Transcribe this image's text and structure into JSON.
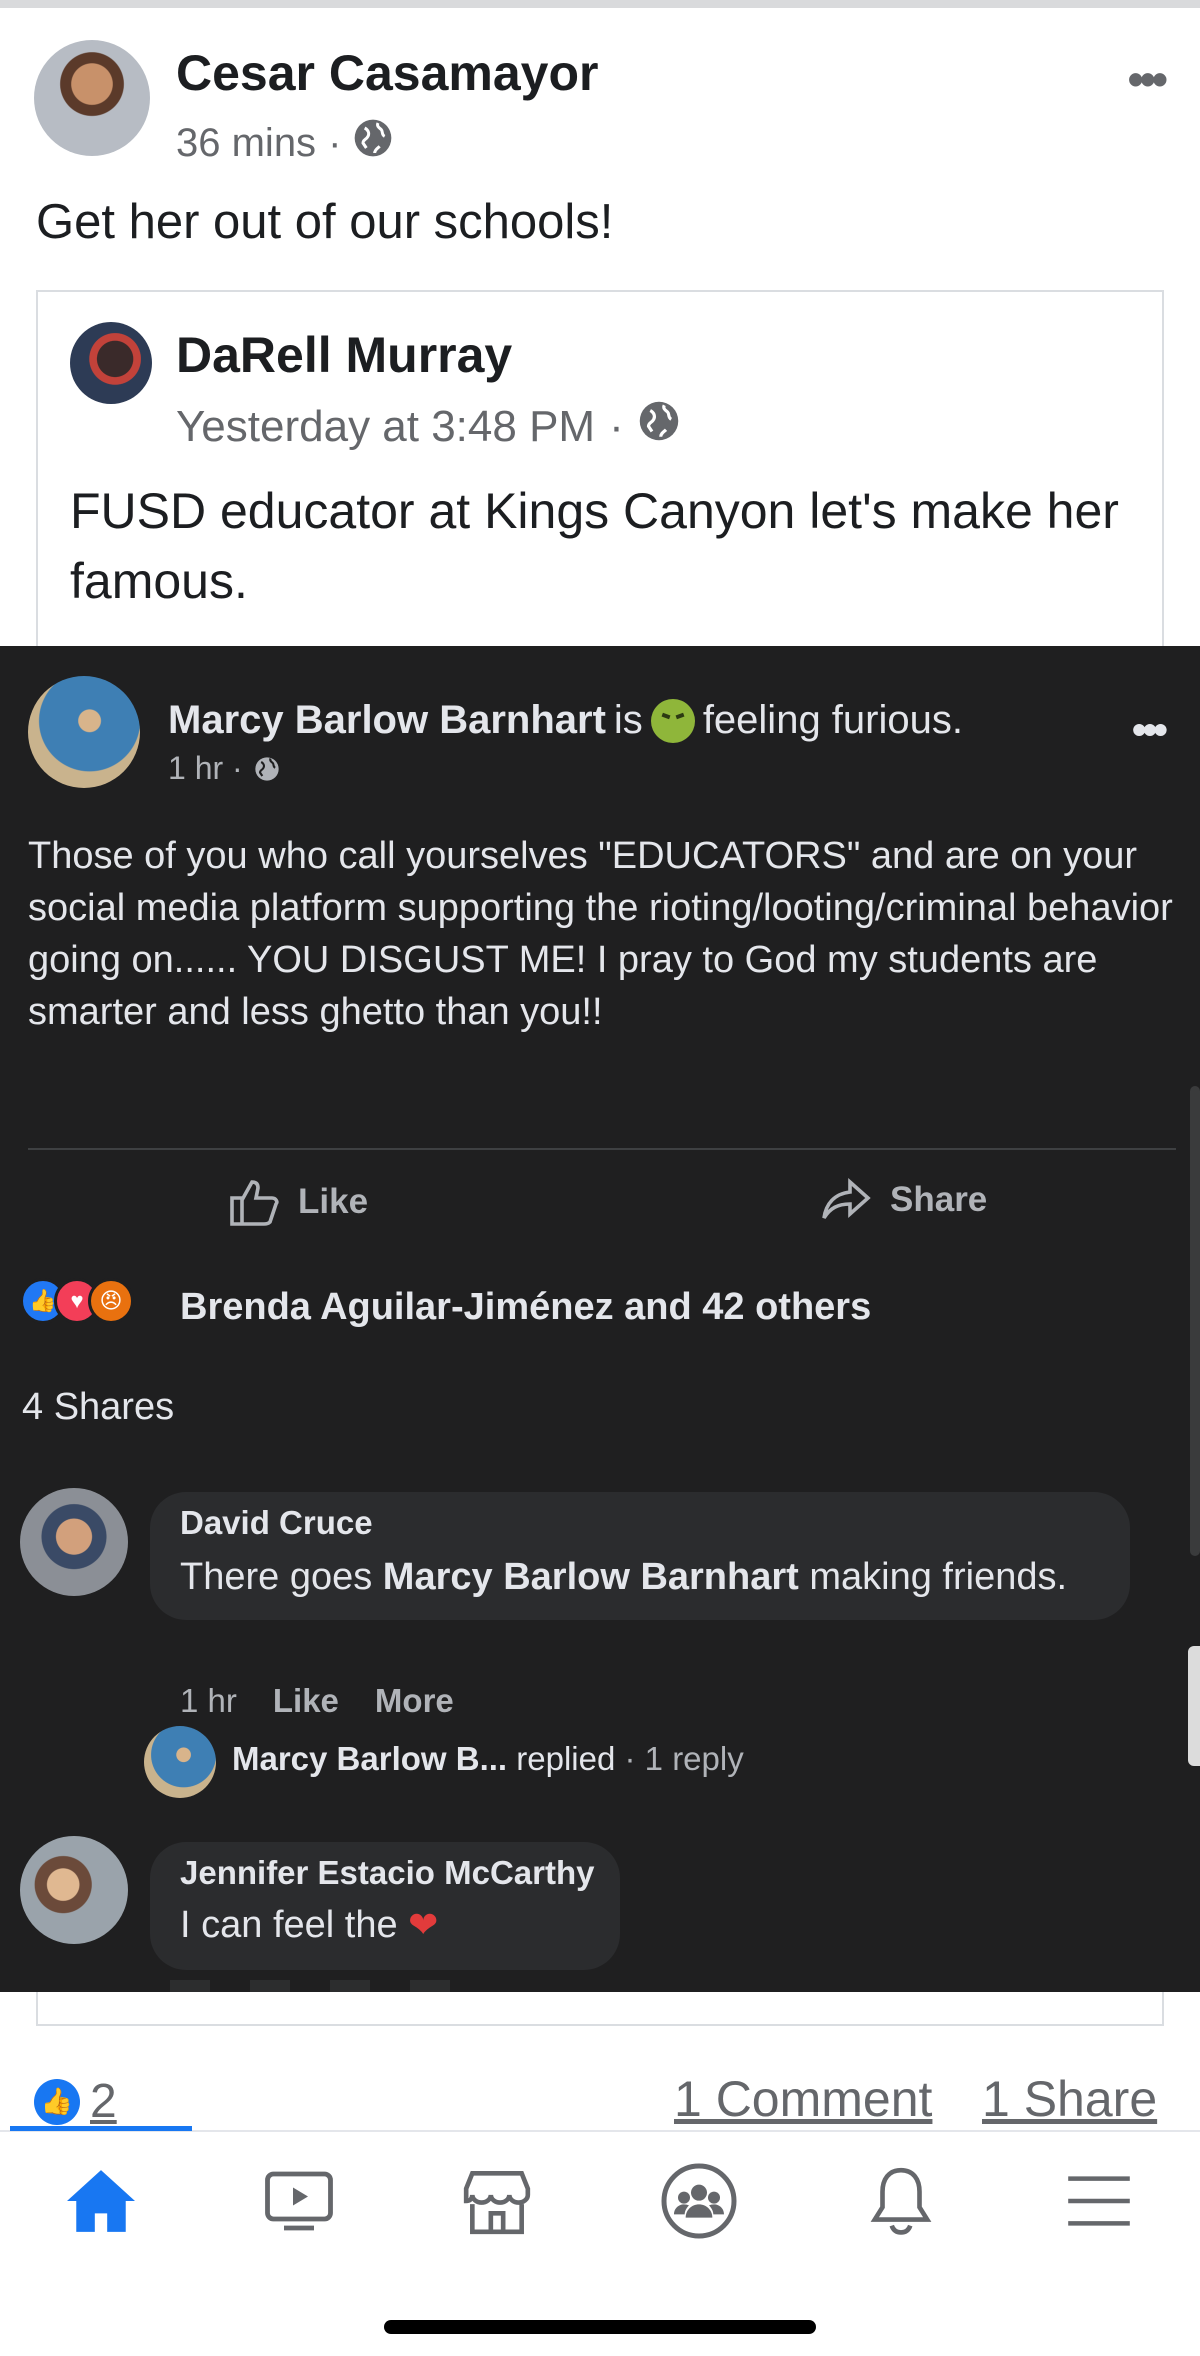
{
  "post": {
    "author": "Cesar Casamayor",
    "time": "36 mins",
    "separator": "·",
    "text": "Get her out of our schools!"
  },
  "shared": {
    "author": "DaRell Murray",
    "time": "Yesterday at 3:48 PM",
    "separator": "·",
    "text": "FUSD educator at Kings Canyon let's make her famous."
  },
  "embedded": {
    "author": "Marcy Barlow Barnhart",
    "is_text": "is",
    "feeling": "feeling furious.",
    "time": "1 hr ·",
    "body": "Those of you who call yourselves \"EDUCATORS\" and are on your social media platform supporting the rioting/looting/criminal behavior going on...... YOU DISGUST ME! I pray to God my students are smarter and less ghetto than you!!",
    "like_label": "Like",
    "share_label": "Share",
    "reactions_text": "Brenda Aguilar-Jiménez and 42 others",
    "shares_text": "4 Shares",
    "comments": [
      {
        "name": "David Cruce",
        "text_before": "There goes ",
        "text_bold": "Marcy Barlow Barnhart",
        "text_after": " making friends.",
        "time": "1 hr",
        "like": "Like",
        "more": "More"
      },
      {
        "name": "Jennifer Estacio McCarthy",
        "text": "I can feel the"
      }
    ],
    "reply": {
      "name": "Marcy Barlow B...",
      "action": "replied",
      "count": "· 1 reply"
    }
  },
  "footer": {
    "like_count": "2",
    "comments": "1 Comment",
    "shares": "1 Share"
  },
  "nav": {
    "items": [
      "home-icon",
      "watch-icon",
      "marketplace-icon",
      "groups-icon",
      "notifications-icon",
      "menu-icon"
    ],
    "active_color": "#1877f2",
    "inactive_color": "#65676b"
  }
}
